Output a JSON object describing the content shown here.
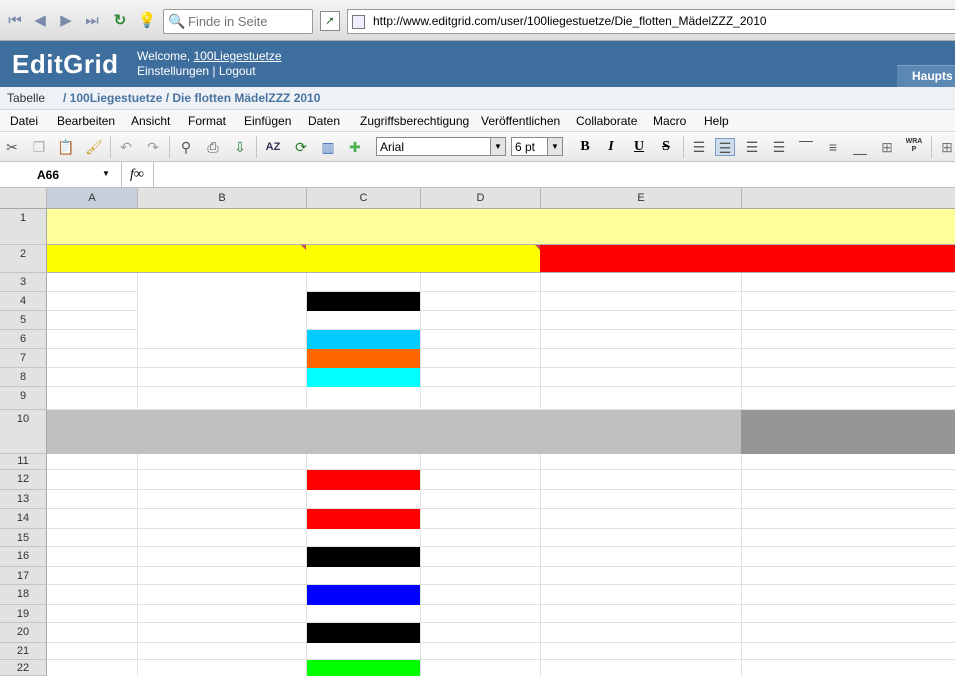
{
  "browser": {
    "find_placeholder": "Finde in Seite",
    "url": "http://www.editgrid.com/user/100liegestuetze/Die_flotten_MädelZZZ_2010"
  },
  "banner": {
    "logo": "EditGrid",
    "welcome_prefix": "Welcome, ",
    "username": "100Liegestuetze",
    "settings": "Einstellungen",
    "separator": " | ",
    "logout": "Logout",
    "home_button": "Haupts"
  },
  "breadcrumb": {
    "label": "Tabelle",
    "path": "/ 100Liegestuetze / Die flotten MädelZZZ 2010"
  },
  "menu": [
    "Datei",
    "Bearbeiten",
    "Ansicht",
    "Format",
    "Einfügen",
    "Daten",
    "Zugriffsberechtigung",
    "Veröffentlichen",
    "Collaborate",
    "Macro",
    "Help"
  ],
  "toolbar": {
    "font": "Arial",
    "font_size": "6 pt",
    "bold": "B",
    "italic": "I",
    "underline": "U",
    "strike": "S",
    "wrap": "WRA P"
  },
  "formula_bar": {
    "cell_ref": "A66",
    "fx": "f∞"
  },
  "sheet": {
    "selected_column": "A",
    "columns": [
      "A",
      "B",
      "C",
      "D",
      "E"
    ],
    "rows": [
      "1",
      "2",
      "3",
      "4",
      "5",
      "6",
      "7",
      "8",
      "9",
      "10",
      "11",
      "12",
      "13",
      "14",
      "15",
      "16",
      "17",
      "18",
      "19",
      "20",
      "21",
      "22"
    ],
    "colors": {
      "light_yellow": "#ffff99",
      "yellow": "#ffff00",
      "red": "#ff0000",
      "black": "#000000",
      "sky_blue": "#00ccff",
      "orange": "#ff6600",
      "cyan": "#00ffff",
      "gray": "#c0c0c0",
      "dark_gray": "#969696",
      "blue": "#0000ff",
      "green": "#00ff00"
    }
  }
}
